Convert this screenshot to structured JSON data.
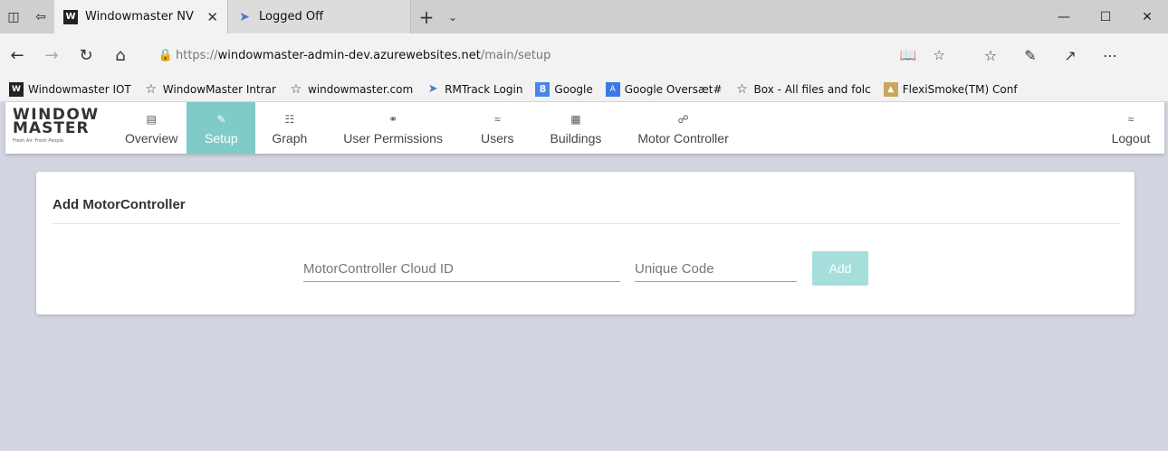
{
  "browser": {
    "tabs": [
      {
        "title": "Windowmaster NV",
        "active": true,
        "icon": "windowmaster-favicon"
      },
      {
        "title": "Logged Off",
        "active": false,
        "icon": "leaf-favicon"
      }
    ],
    "address": {
      "protocol": "https://",
      "host": "windowmaster-admin-dev.azurewebsites.net",
      "path": "/main/setup"
    },
    "favorites": [
      {
        "label": "Windowmaster IOT",
        "icon": "windowmaster-icon"
      },
      {
        "label": "WindowMaster Intrar",
        "icon": "star-icon"
      },
      {
        "label": "windowmaster.com",
        "icon": "star-icon"
      },
      {
        "label": "RMTrack Login",
        "icon": "rmtrack-icon"
      },
      {
        "label": "Google",
        "icon": "google-icon"
      },
      {
        "label": "Google Oversæt#",
        "icon": "google-translate-icon"
      },
      {
        "label": "Box - All files and folc",
        "icon": "star-icon"
      },
      {
        "label": "FlexiSmoke(TM) Conf",
        "icon": "flexismoke-icon"
      }
    ]
  },
  "app": {
    "logo": {
      "line1": "WINDOW",
      "line2": "MASTER",
      "tagline": "Fresh Air. Fresh People."
    },
    "nav": [
      {
        "label": "Overview",
        "icon": "overview-icon",
        "active": false
      },
      {
        "label": "Setup",
        "icon": "wrench-icon",
        "active": true
      },
      {
        "label": "Graph",
        "icon": "graph-icon",
        "active": false
      },
      {
        "label": "User Permissions",
        "icon": "permissions-icon",
        "active": false
      },
      {
        "label": "Users",
        "icon": "users-icon",
        "active": false
      },
      {
        "label": "Buildings",
        "icon": "buildings-icon",
        "active": false
      },
      {
        "label": "Motor Controller",
        "icon": "motor-controller-icon",
        "active": false
      }
    ],
    "logout": {
      "label": "Logout",
      "icon": "users-icon"
    }
  },
  "card": {
    "title": "Add MotorController",
    "cloud_id": {
      "value": "",
      "placeholder": "MotorController Cloud ID"
    },
    "unique_code": {
      "value": "",
      "placeholder": "Unique Code"
    },
    "add_label": "Add"
  },
  "colors": {
    "accent": "#7fcbc9",
    "add_button": "#a6dedc",
    "page_background": "#d2d6e0"
  }
}
